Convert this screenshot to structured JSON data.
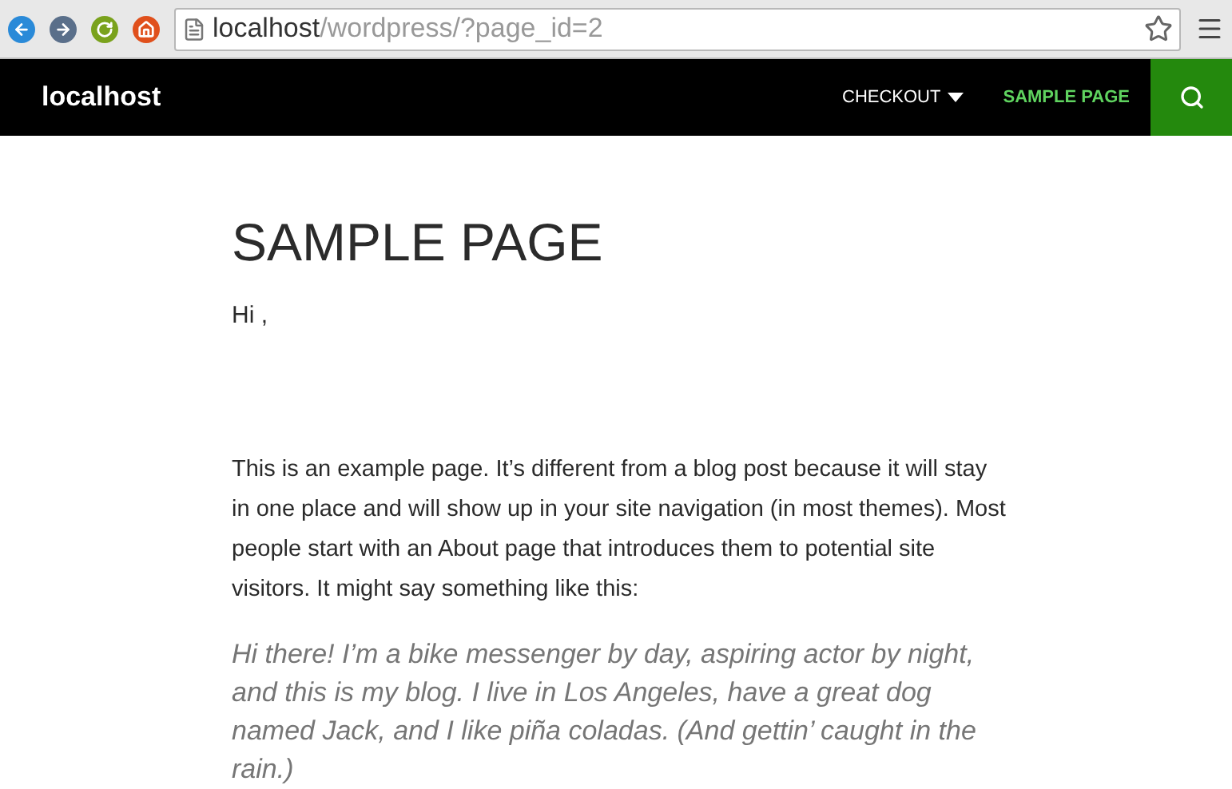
{
  "browser": {
    "address_host": "localhost",
    "address_path": "/wordpress/?page_id=2"
  },
  "site": {
    "title": "localhost"
  },
  "nav": [
    {
      "label": "CHECKOUT",
      "dropdown": true,
      "selected": false
    },
    {
      "label": "SAMPLE PAGE",
      "dropdown": false,
      "selected": true
    }
  ],
  "page": {
    "title": "SAMPLE PAGE",
    "greeting": "Hi ,",
    "paragraph": "This is an example page. It’s different from a blog post because it will stay in one place and will show up in your site navigation (in most themes). Most people start with an About page that introduces them to potential site visitors. It might say something like this:",
    "quote": "Hi there! I’m a bike messenger by day, aspiring actor by night, and this is my blog. I live in Los Angeles, have a great dog named Jack, and I like piña coladas. (And gettin’ caught in the rain.)"
  }
}
